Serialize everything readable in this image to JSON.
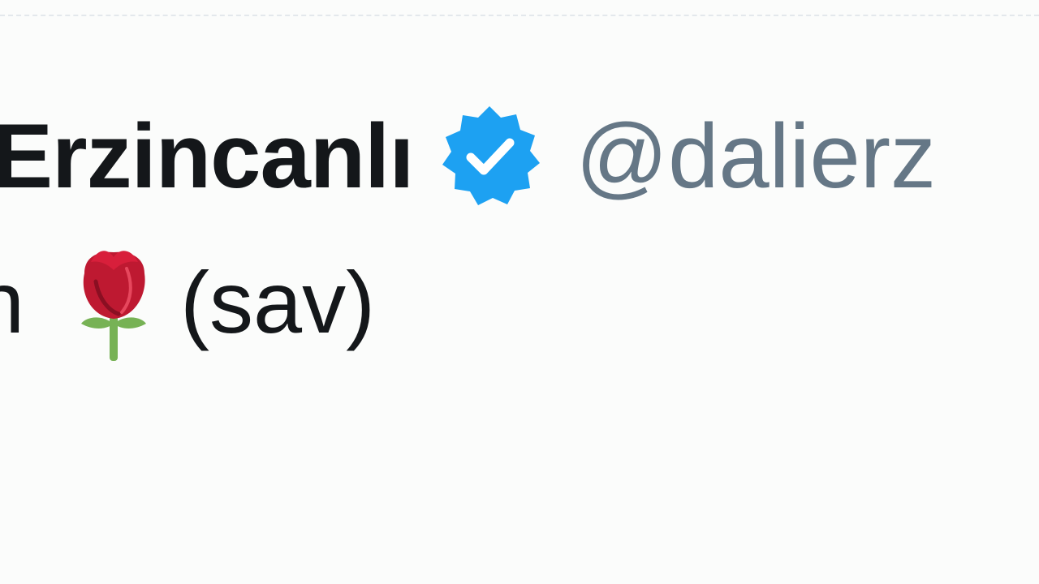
{
  "tweet": {
    "author": {
      "display_name": "li Erzincanlı",
      "handle": "@dalierz",
      "verified_icon": "verified-badge-icon",
      "badge_color": "#1da1f2"
    },
    "text": {
      "leading_fragment": "n",
      "emoji": "rose-icon",
      "trailing": "(sav)"
    }
  },
  "colors": {
    "background": "#fbfcfb",
    "name_text": "#14171a",
    "handle_text": "#657786",
    "divider": "#e3e8ec"
  }
}
